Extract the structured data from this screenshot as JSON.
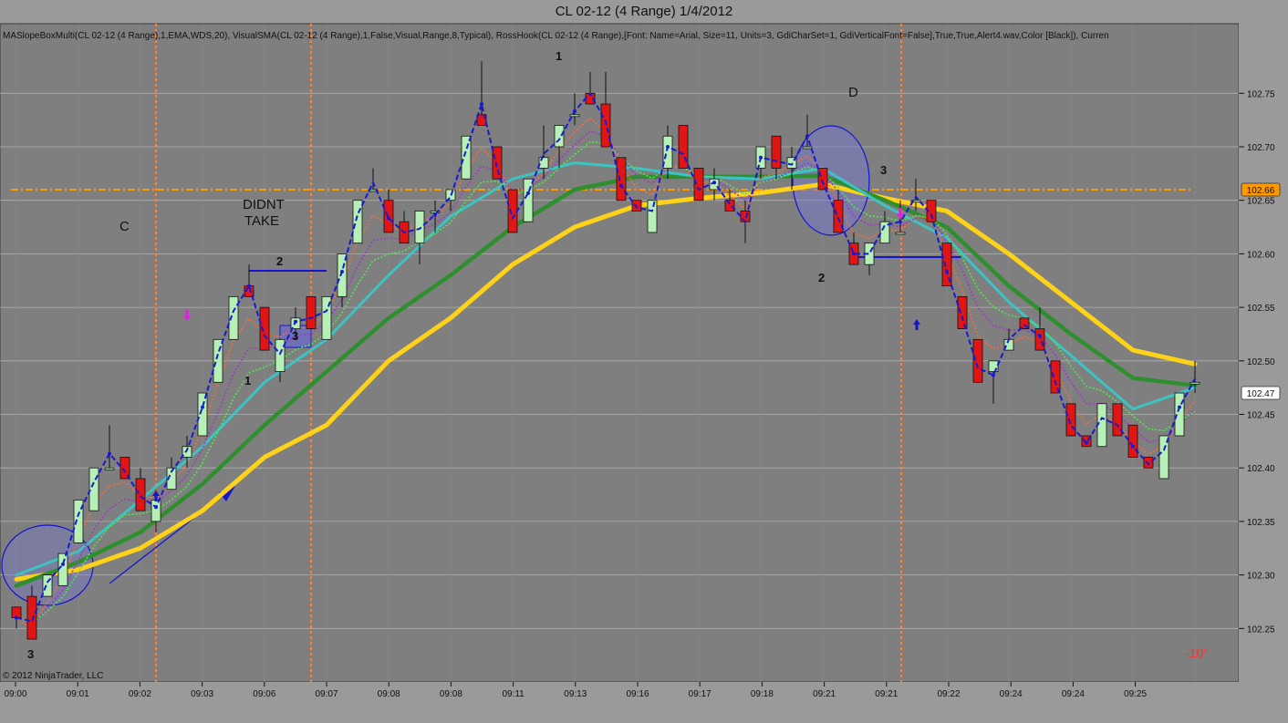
{
  "window": {
    "title": "CL 02-12 (4 Range)  1/4/2012",
    "indicator_line": "MASlopeBoxMulti(CL 02-12 (4 Range),1,EMA,WDS,20), VisualSMA(CL 02-12 (4 Range),1,False,Visual,Range,8,Typical), RossHook(CL 02-12 (4 Range),[Font: Name=Arial, Size=11, Units=3, GdiCharSet=1, GdiVerticalFont=False],True,True,Alert4.wav,Color [Black]), Curren",
    "copyright": "© 2012 NinjaTrader, LLC",
    "angle_readout": "-10°"
  },
  "colors": {
    "background": "#7f7f7f",
    "up_candle": "#b6f0b6",
    "down_candle": "#e01515",
    "ema_yellow": "#ffd21a",
    "ema_green": "#2f8f2f",
    "ma_cyan": "#3cc3c3",
    "blue_dashed": "#1a1ad0",
    "horizontal_level": "#ff9900",
    "session_lines": "#ff8040"
  },
  "chart_data": {
    "type": "candlestick",
    "symbol": "CL 02-12 (4 Range)",
    "date": "1/4/2012",
    "ylim": [
      102.2,
      102.815
    ],
    "y_ticks": [
      102.25,
      102.3,
      102.35,
      102.4,
      102.45,
      102.5,
      102.55,
      102.6,
      102.65,
      102.7,
      102.75
    ],
    "x_tick_labels": [
      "09:00",
      "09:01",
      "09:02",
      "09:03",
      "09:06",
      "09:07",
      "09:08",
      "09:08",
      "09:11",
      "09:13",
      "09:16",
      "09:17",
      "09:18",
      "09:21",
      "09:21",
      "09:22",
      "09:24",
      "09:24",
      "09:25"
    ],
    "price_markers": [
      {
        "label": "102.66",
        "value": 102.66,
        "color": "#ff9900"
      },
      {
        "label": "102.47",
        "value": 102.47,
        "color": "#ffffff"
      }
    ],
    "horizontal_level": 102.66,
    "candles": [
      [
        102.27,
        102.27,
        102.25,
        102.26
      ],
      [
        102.28,
        102.29,
        102.24,
        102.24
      ],
      [
        102.28,
        102.3,
        102.28,
        102.3
      ],
      [
        102.29,
        102.32,
        102.29,
        102.32
      ],
      [
        102.33,
        102.37,
        102.33,
        102.37
      ],
      [
        102.36,
        102.4,
        102.36,
        102.4
      ],
      [
        102.4,
        102.44,
        102.4,
        102.4
      ],
      [
        102.41,
        102.41,
        102.39,
        102.39
      ],
      [
        102.39,
        102.4,
        102.36,
        102.36
      ],
      [
        102.35,
        102.38,
        102.34,
        102.37
      ],
      [
        102.38,
        102.41,
        102.38,
        102.4
      ],
      [
        102.41,
        102.43,
        102.4,
        102.42
      ],
      [
        102.43,
        102.47,
        102.43,
        102.47
      ],
      [
        102.48,
        102.52,
        102.48,
        102.52
      ],
      [
        102.52,
        102.56,
        102.52,
        102.56
      ],
      [
        102.57,
        102.59,
        102.56,
        102.56
      ],
      [
        102.55,
        102.55,
        102.51,
        102.51
      ],
      [
        102.49,
        102.52,
        102.48,
        102.52
      ],
      [
        102.53,
        102.55,
        102.52,
        102.54
      ],
      [
        102.56,
        102.56,
        102.53,
        102.53
      ],
      [
        102.52,
        102.56,
        102.52,
        102.56
      ],
      [
        102.56,
        102.6,
        102.55,
        102.6
      ],
      [
        102.61,
        102.65,
        102.61,
        102.65
      ],
      [
        102.66,
        102.68,
        102.66,
        102.66
      ],
      [
        102.65,
        102.66,
        102.62,
        102.62
      ],
      [
        102.63,
        102.64,
        102.61,
        102.61
      ],
      [
        102.61,
        102.64,
        102.59,
        102.64
      ],
      [
        102.64,
        102.65,
        102.62,
        102.64
      ],
      [
        102.65,
        102.66,
        102.64,
        102.66
      ],
      [
        102.67,
        102.71,
        102.67,
        102.71
      ],
      [
        102.73,
        102.78,
        102.72,
        102.72
      ],
      [
        102.7,
        102.7,
        102.67,
        102.67
      ],
      [
        102.66,
        102.66,
        102.62,
        102.62
      ],
      [
        102.63,
        102.67,
        102.63,
        102.67
      ],
      [
        102.68,
        102.72,
        102.67,
        102.69
      ],
      [
        102.7,
        102.72,
        102.68,
        102.72
      ],
      [
        102.73,
        102.75,
        102.72,
        102.73
      ],
      [
        102.75,
        102.77,
        102.74,
        102.74
      ],
      [
        102.74,
        102.77,
        102.7,
        102.7
      ],
      [
        102.69,
        102.69,
        102.65,
        102.65
      ],
      [
        102.65,
        102.65,
        102.64,
        102.64
      ],
      [
        102.62,
        102.65,
        102.62,
        102.65
      ],
      [
        102.68,
        102.72,
        102.67,
        102.71
      ],
      [
        102.72,
        102.72,
        102.68,
        102.68
      ],
      [
        102.68,
        102.68,
        102.65,
        102.65
      ],
      [
        102.66,
        102.68,
        102.65,
        102.67
      ],
      [
        102.65,
        102.66,
        102.64,
        102.64
      ],
      [
        102.64,
        102.65,
        102.61,
        102.63
      ],
      [
        102.68,
        102.7,
        102.67,
        102.7
      ],
      [
        102.71,
        102.71,
        102.67,
        102.68
      ],
      [
        102.68,
        102.7,
        102.66,
        102.69
      ],
      [
        102.7,
        102.73,
        102.7,
        102.7
      ],
      [
        102.68,
        102.68,
        102.66,
        102.66
      ],
      [
        102.65,
        102.66,
        102.62,
        102.62
      ],
      [
        102.61,
        102.62,
        102.59,
        102.59
      ],
      [
        102.59,
        102.61,
        102.58,
        102.61
      ],
      [
        102.61,
        102.64,
        102.61,
        102.63
      ],
      [
        102.62,
        102.65,
        102.62,
        102.62
      ],
      [
        102.65,
        102.67,
        102.64,
        102.65
      ],
      [
        102.65,
        102.65,
        102.63,
        102.63
      ],
      [
        102.61,
        102.61,
        102.57,
        102.57
      ],
      [
        102.56,
        102.56,
        102.53,
        102.53
      ],
      [
        102.52,
        102.52,
        102.48,
        102.48
      ],
      [
        102.49,
        102.5,
        102.46,
        102.5
      ],
      [
        102.51,
        102.53,
        102.51,
        102.52
      ],
      [
        102.54,
        102.54,
        102.53,
        102.53
      ],
      [
        102.53,
        102.55,
        102.51,
        102.51
      ],
      [
        102.5,
        102.5,
        102.47,
        102.47
      ],
      [
        102.46,
        102.46,
        102.43,
        102.43
      ],
      [
        102.43,
        102.43,
        102.42,
        102.42
      ],
      [
        102.42,
        102.46,
        102.42,
        102.46
      ],
      [
        102.46,
        102.46,
        102.43,
        102.43
      ],
      [
        102.44,
        102.44,
        102.41,
        102.41
      ],
      [
        102.41,
        102.41,
        102.4,
        102.4
      ],
      [
        102.39,
        102.43,
        102.39,
        102.43
      ],
      [
        102.43,
        102.47,
        102.43,
        102.47
      ],
      [
        102.48,
        102.5,
        102.47,
        102.48
      ]
    ],
    "series": [
      {
        "name": "",
        "color": "#ffd21a",
        "points": [
          [
            0,
            102.296
          ],
          [
            4,
            102.305
          ],
          [
            8,
            102.325
          ],
          [
            12,
            102.36
          ],
          [
            16,
            102.41
          ],
          [
            20,
            102.44
          ],
          [
            24,
            102.5
          ],
          [
            28,
            102.54
          ],
          [
            32,
            102.59
          ],
          [
            36,
            102.625
          ],
          [
            40,
            102.645
          ],
          [
            44,
            102.652
          ],
          [
            48,
            102.657
          ],
          [
            52,
            102.665
          ],
          [
            56,
            102.652
          ],
          [
            60,
            102.64
          ],
          [
            64,
            102.6
          ],
          [
            68,
            102.555
          ],
          [
            72,
            102.51
          ],
          [
            76,
            102.497
          ]
        ]
      },
      {
        "name": "",
        "color": "#2f8f2f",
        "points": [
          [
            0,
            102.29
          ],
          [
            4,
            102.312
          ],
          [
            8,
            102.34
          ],
          [
            12,
            102.385
          ],
          [
            16,
            102.44
          ],
          [
            20,
            102.49
          ],
          [
            24,
            102.54
          ],
          [
            28,
            102.58
          ],
          [
            32,
            102.625
          ],
          [
            36,
            102.66
          ],
          [
            40,
            102.672
          ],
          [
            44,
            102.672
          ],
          [
            48,
            102.672
          ],
          [
            52,
            102.673
          ],
          [
            56,
            102.65
          ],
          [
            60,
            102.625
          ],
          [
            64,
            102.57
          ],
          [
            68,
            102.525
          ],
          [
            72,
            102.484
          ],
          [
            76,
            102.477
          ]
        ]
      },
      {
        "name": "",
        "color": "#3cc3c3",
        "points": [
          [
            0,
            102.3
          ],
          [
            4,
            102.322
          ],
          [
            8,
            102.37
          ],
          [
            12,
            102.42
          ],
          [
            16,
            102.48
          ],
          [
            20,
            102.52
          ],
          [
            24,
            102.58
          ],
          [
            28,
            102.635
          ],
          [
            32,
            102.67
          ],
          [
            36,
            102.685
          ],
          [
            40,
            102.68
          ],
          [
            44,
            102.672
          ],
          [
            48,
            102.67
          ],
          [
            52,
            102.68
          ],
          [
            56,
            102.645
          ],
          [
            60,
            102.615
          ],
          [
            64,
            102.555
          ],
          [
            68,
            102.505
          ],
          [
            72,
            102.455
          ],
          [
            76,
            102.475
          ]
        ]
      }
    ]
  },
  "annotations": {
    "labels": [
      {
        "text": "C"
      },
      {
        "text": "DIDNT"
      },
      {
        "text": "TAKE"
      },
      {
        "text": "D"
      },
      {
        "text": "1"
      },
      {
        "text": "2"
      },
      {
        "text": "3"
      },
      {
        "text": "3"
      },
      {
        "text": "1"
      },
      {
        "text": "2"
      },
      {
        "text": "3"
      }
    ]
  }
}
